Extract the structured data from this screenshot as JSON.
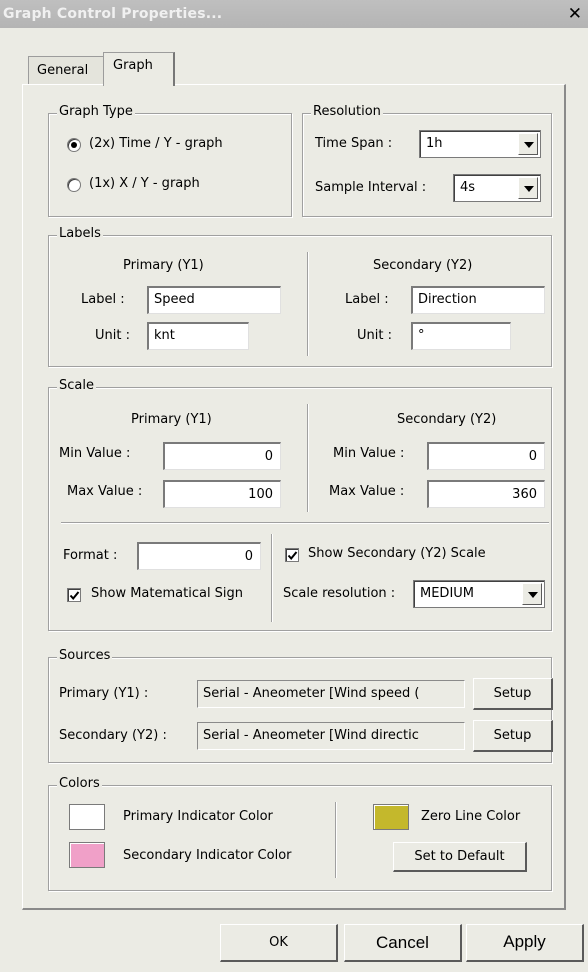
{
  "window": {
    "title": "Graph Control Properties...",
    "close_glyph": "✕"
  },
  "tabs": [
    {
      "label": "General"
    },
    {
      "label": "Graph"
    }
  ],
  "graph_type": {
    "legend": "Graph Type",
    "options": [
      {
        "label": "(2x) Time / Y - graph",
        "selected": true
      },
      {
        "label": "(1x) X / Y - graph",
        "selected": false
      }
    ]
  },
  "resolution": {
    "legend": "Resolution",
    "time_span_label": "Time Span :",
    "time_span_value": "1h",
    "sample_interval_label": "Sample Interval :",
    "sample_interval_value": "4s"
  },
  "labels": {
    "legend": "Labels",
    "primary_heading": "Primary (Y1)",
    "secondary_heading": "Secondary (Y2)",
    "label_caption": "Label :",
    "unit_caption": "Unit :",
    "primary_label_value": "Speed",
    "primary_unit_value": "knt",
    "secondary_label_value": "Direction",
    "secondary_unit_value": "°"
  },
  "scale": {
    "legend": "Scale",
    "primary_heading": "Primary (Y1)",
    "secondary_heading": "Secondary (Y2)",
    "min_caption": "Min Value :",
    "max_caption": "Max Value :",
    "primary_min": "0",
    "primary_max": "100",
    "secondary_min": "0",
    "secondary_max": "360",
    "format_caption": "Format :",
    "format_value": "0",
    "show_sign_label": "Show Matematical Sign",
    "show_sign_checked": true,
    "show_secondary_label": "Show Secondary (Y2) Scale",
    "show_secondary_checked": true,
    "scale_resolution_caption": "Scale resolution :",
    "scale_resolution_value": "MEDIUM"
  },
  "sources": {
    "legend": "Sources",
    "primary_caption": "Primary (Y1) :",
    "primary_value": "Serial - Aneometer [Wind speed (",
    "secondary_caption": "Secondary (Y2) :",
    "secondary_value": "Serial - Aneometer [Wind directic",
    "setup_label": "Setup"
  },
  "colors": {
    "legend": "Colors",
    "primary_indicator_label": "Primary Indicator Color",
    "primary_indicator_color": "#ffffff",
    "secondary_indicator_label": "Secondary Indicator Color",
    "secondary_indicator_color": "#f0a0c8",
    "zero_line_label": "Zero Line Color",
    "zero_line_color": "#c4b82c",
    "set_default_label": "Set to Default"
  },
  "footer": {
    "ok_label": "OK",
    "cancel_label": "Cancel",
    "apply_label": "Apply"
  }
}
